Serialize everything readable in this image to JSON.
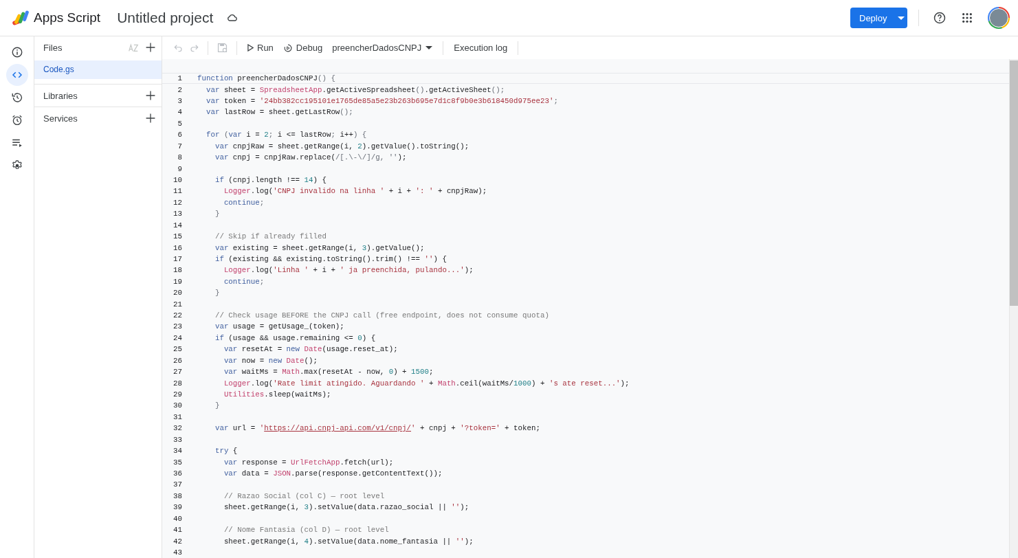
{
  "header": {
    "product": "Apps Script",
    "project_title": "Untitled project",
    "deploy": "Deploy"
  },
  "rail": [
    {
      "kind": "info",
      "selected": false
    },
    {
      "kind": "code",
      "selected": true
    },
    {
      "kind": "history",
      "selected": false
    },
    {
      "kind": "alarm",
      "selected": false
    },
    {
      "kind": "executions",
      "selected": false
    },
    {
      "kind": "settings",
      "selected": false
    }
  ],
  "files_panel": {
    "title": "Files",
    "files": [
      {
        "name": "Code.gs",
        "selected": true
      }
    ],
    "sections": [
      {
        "label": "Libraries"
      },
      {
        "label": "Services"
      }
    ]
  },
  "toolbar": {
    "run": "Run",
    "debug": "Debug",
    "function": "preencherDadosCNPJ",
    "log": "Execution log"
  },
  "editor": {
    "lines": [
      {
        "n": "1",
        "active": true,
        "t": [
          {
            "kind": "kw",
            "text": "function"
          },
          {
            "kind": "id",
            "text": " preencherDadosCNPJ"
          },
          {
            "kind": "p",
            "text": "() {"
          }
        ]
      },
      {
        "n": "2",
        "active": false,
        "t": [
          {
            "kind": "kw",
            "text": "  var"
          },
          {
            "kind": "id",
            "text": " sheet = "
          },
          {
            "kind": "cls",
            "text": "SpreadsheetApp"
          },
          {
            "kind": "id",
            "text": ".getActiveSpreadsheet"
          },
          {
            "kind": "p",
            "text": "()"
          },
          {
            "kind": "id",
            "text": ".getActiveSheet"
          },
          {
            "kind": "p",
            "text": "();"
          }
        ]
      },
      {
        "n": "3",
        "active": false,
        "t": [
          {
            "kind": "kw",
            "text": "  var"
          },
          {
            "kind": "id",
            "text": " token = "
          },
          {
            "kind": "str",
            "text": "'24bb382cc195101e1765de85a5e23b263b695e7d1c8f9b0e3b618450d975ee23'"
          },
          {
            "kind": "p",
            "text": ";"
          }
        ]
      },
      {
        "n": "4",
        "active": false,
        "t": [
          {
            "kind": "kw",
            "text": "  var"
          },
          {
            "kind": "id",
            "text": " lastRow = sheet.getLastRow"
          },
          {
            "kind": "p",
            "text": "();"
          }
        ]
      },
      {
        "n": "5",
        "active": false
      },
      {
        "n": "6",
        "active": false,
        "t": [
          {
            "kind": "kw",
            "text": "  for"
          },
          {
            "kind": "p",
            "text": " ("
          },
          {
            "kind": "kw",
            "text": "var"
          },
          {
            "kind": "id",
            "text": " i = "
          },
          {
            "kind": "num",
            "text": "2"
          },
          {
            "kind": "p",
            "text": "; "
          },
          {
            "kind": "id",
            "text": "i <= lastRow"
          },
          {
            "kind": "p",
            "text": "; "
          },
          {
            "kind": "id",
            "text": "i++"
          },
          {
            "kind": "p",
            "text": ") {"
          }
        ]
      },
      {
        "n": "7",
        "active": false,
        "t": [
          {
            "kind": "kw",
            "text": "    var"
          },
          {
            "kind": "id",
            "text": " cnpjRaw = sheet.getRange(i, "
          },
          {
            "kind": "num",
            "text": "2"
          },
          {
            "kind": "id",
            "text": ").getValue().toString();"
          }
        ]
      },
      {
        "n": "8",
        "active": false,
        "t": [
          {
            "kind": "kw",
            "text": "    var"
          },
          {
            "kind": "id",
            "text": " cnpj = cnpjRaw.replace("
          },
          {
            "kind": "p",
            "text": "/[.\\-\\/]/g, ''"
          },
          {
            "kind": "id",
            "text": ");"
          }
        ]
      },
      {
        "n": "9",
        "active": false
      },
      {
        "n": "10",
        "active": false,
        "t": [
          {
            "kind": "kw",
            "text": "    if"
          },
          {
            "kind": "id",
            "text": " (cnpj.length !== "
          },
          {
            "kind": "num",
            "text": "14"
          },
          {
            "kind": "id",
            "text": ") {"
          }
        ]
      },
      {
        "n": "11",
        "active": false,
        "t": [
          {
            "kind": "cls",
            "text": "      Logger"
          },
          {
            "kind": "id",
            "text": ".log("
          },
          {
            "kind": "str",
            "text": "'CNPJ invalido na linha '"
          },
          {
            "kind": "id",
            "text": " + i + "
          },
          {
            "kind": "str",
            "text": "': '"
          },
          {
            "kind": "id",
            "text": " + cnpjRaw);"
          }
        ]
      },
      {
        "n": "12",
        "active": false,
        "t": [
          {
            "kind": "kw",
            "text": "      continue"
          },
          {
            "kind": "p",
            "text": ";"
          }
        ]
      },
      {
        "n": "13",
        "active": false,
        "t": [
          {
            "kind": "p",
            "text": "    }"
          }
        ]
      },
      {
        "n": "14",
        "active": false
      },
      {
        "n": "15",
        "active": false,
        "t": [
          {
            "kind": "cm",
            "text": "    // Skip if already filled"
          }
        ]
      },
      {
        "n": "16",
        "active": false,
        "t": [
          {
            "kind": "kw",
            "text": "    var"
          },
          {
            "kind": "id",
            "text": " existing = sheet.getRange(i, "
          },
          {
            "kind": "num",
            "text": "3"
          },
          {
            "kind": "id",
            "text": ").getValue();"
          }
        ]
      },
      {
        "n": "17",
        "active": false,
        "t": [
          {
            "kind": "kw",
            "text": "    if"
          },
          {
            "kind": "id",
            "text": " (existing && existing.toString().trim() !== "
          },
          {
            "kind": "str",
            "text": "''"
          },
          {
            "kind": "id",
            "text": ") {"
          }
        ]
      },
      {
        "n": "18",
        "active": false,
        "t": [
          {
            "kind": "cls",
            "text": "      Logger"
          },
          {
            "kind": "id",
            "text": ".log("
          },
          {
            "kind": "str",
            "text": "'Linha '"
          },
          {
            "kind": "id",
            "text": " + i + "
          },
          {
            "kind": "str",
            "text": "' ja preenchida, pulando...'"
          },
          {
            "kind": "id",
            "text": ");"
          }
        ]
      },
      {
        "n": "19",
        "active": false,
        "t": [
          {
            "kind": "kw",
            "text": "      continue"
          },
          {
            "kind": "p",
            "text": ";"
          }
        ]
      },
      {
        "n": "20",
        "active": false,
        "t": [
          {
            "kind": "p",
            "text": "    }"
          }
        ]
      },
      {
        "n": "21",
        "active": false
      },
      {
        "n": "22",
        "active": false,
        "t": [
          {
            "kind": "cm",
            "text": "    // Check usage BEFORE the CNPJ call (free endpoint, does not consume quota)"
          }
        ]
      },
      {
        "n": "23",
        "active": false,
        "t": [
          {
            "kind": "kw",
            "text": "    var"
          },
          {
            "kind": "id",
            "text": " usage = getUsage_(token);"
          }
        ]
      },
      {
        "n": "24",
        "active": false,
        "t": [
          {
            "kind": "kw",
            "text": "    if"
          },
          {
            "kind": "id",
            "text": " (usage && usage.remaining <= "
          },
          {
            "kind": "num",
            "text": "0"
          },
          {
            "kind": "id",
            "text": ") {"
          }
        ]
      },
      {
        "n": "25",
        "active": false,
        "t": [
          {
            "kind": "kw",
            "text": "      var"
          },
          {
            "kind": "id",
            "text": " resetAt = "
          },
          {
            "kind": "kw",
            "text": "new"
          },
          {
            "kind": "cls",
            "text": " Date"
          },
          {
            "kind": "id",
            "text": "(usage.reset_at);"
          }
        ]
      },
      {
        "n": "26",
        "active": false,
        "t": [
          {
            "kind": "kw",
            "text": "      var"
          },
          {
            "kind": "id",
            "text": " now = "
          },
          {
            "kind": "kw",
            "text": "new"
          },
          {
            "kind": "cls",
            "text": " Date"
          },
          {
            "kind": "id",
            "text": "();"
          }
        ]
      },
      {
        "n": "27",
        "active": false,
        "t": [
          {
            "kind": "kw",
            "text": "      var"
          },
          {
            "kind": "id",
            "text": " waitMs = "
          },
          {
            "kind": "cls",
            "text": "Math"
          },
          {
            "kind": "id",
            "text": ".max(resetAt - now, "
          },
          {
            "kind": "num",
            "text": "0"
          },
          {
            "kind": "id",
            "text": ") + "
          },
          {
            "kind": "num",
            "text": "1500"
          },
          {
            "kind": "id",
            "text": ";"
          }
        ]
      },
      {
        "n": "28",
        "active": false,
        "t": [
          {
            "kind": "cls",
            "text": "      Logger"
          },
          {
            "kind": "id",
            "text": ".log("
          },
          {
            "kind": "str",
            "text": "'Rate limit atingido. Aguardando '"
          },
          {
            "kind": "id",
            "text": " + "
          },
          {
            "kind": "cls",
            "text": "Math"
          },
          {
            "kind": "id",
            "text": ".ceil(waitMs/"
          },
          {
            "kind": "num",
            "text": "1000"
          },
          {
            "kind": "id",
            "text": ") + "
          },
          {
            "kind": "str",
            "text": "'s ate reset...'"
          },
          {
            "kind": "id",
            "text": ");"
          }
        ]
      },
      {
        "n": "29",
        "active": false,
        "t": [
          {
            "kind": "cls",
            "text": "      Utilities"
          },
          {
            "kind": "id",
            "text": ".sleep(waitMs);"
          }
        ]
      },
      {
        "n": "30",
        "active": false,
        "t": [
          {
            "kind": "p",
            "text": "    }"
          }
        ]
      },
      {
        "n": "31",
        "active": false
      },
      {
        "n": "32",
        "active": false,
        "t": [
          {
            "kind": "kw",
            "text": "    var"
          },
          {
            "kind": "id",
            "text": " url = "
          },
          {
            "kind": "str",
            "text": "'"
          },
          {
            "kind": "link",
            "text": "https://api.cnpj-api.com/v1/cnpj/"
          },
          {
            "kind": "str",
            "text": "'"
          },
          {
            "kind": "id",
            "text": " + cnpj + "
          },
          {
            "kind": "str",
            "text": "'?token='"
          },
          {
            "kind": "id",
            "text": " + token;"
          }
        ]
      },
      {
        "n": "33",
        "active": false
      },
      {
        "n": "34",
        "active": false,
        "t": [
          {
            "kind": "kw",
            "text": "    try"
          },
          {
            "kind": "id",
            "text": " {"
          }
        ]
      },
      {
        "n": "35",
        "active": false,
        "t": [
          {
            "kind": "kw",
            "text": "      var"
          },
          {
            "kind": "id",
            "text": " response = "
          },
          {
            "kind": "cls",
            "text": "UrlFetchApp"
          },
          {
            "kind": "id",
            "text": ".fetch(url);"
          }
        ]
      },
      {
        "n": "36",
        "active": false,
        "t": [
          {
            "kind": "kw",
            "text": "      var"
          },
          {
            "kind": "id",
            "text": " data = "
          },
          {
            "kind": "cls",
            "text": "JSON"
          },
          {
            "kind": "id",
            "text": ".parse(response.getContentText());"
          }
        ]
      },
      {
        "n": "37",
        "active": false
      },
      {
        "n": "38",
        "active": false,
        "t": [
          {
            "kind": "cm",
            "text": "      // Razao Social (col C) — root level"
          }
        ]
      },
      {
        "n": "39",
        "active": false,
        "t": [
          {
            "kind": "id",
            "text": "      sheet.getRange(i, "
          },
          {
            "kind": "num",
            "text": "3"
          },
          {
            "kind": "id",
            "text": ").setValue(data.razao_social || "
          },
          {
            "kind": "str",
            "text": "''"
          },
          {
            "kind": "id",
            "text": ");"
          }
        ]
      },
      {
        "n": "40",
        "active": false
      },
      {
        "n": "41",
        "active": false,
        "t": [
          {
            "kind": "cm",
            "text": "      // Nome Fantasia (col D) — root level"
          }
        ]
      },
      {
        "n": "42",
        "active": false,
        "t": [
          {
            "kind": "id",
            "text": "      sheet.getRange(i, "
          },
          {
            "kind": "num",
            "text": "4"
          },
          {
            "kind": "id",
            "text": ").setValue(data.nome_fantasia || "
          },
          {
            "kind": "str",
            "text": "''"
          },
          {
            "kind": "id",
            "text": ");"
          }
        ]
      },
      {
        "n": "43",
        "active": false
      }
    ]
  }
}
